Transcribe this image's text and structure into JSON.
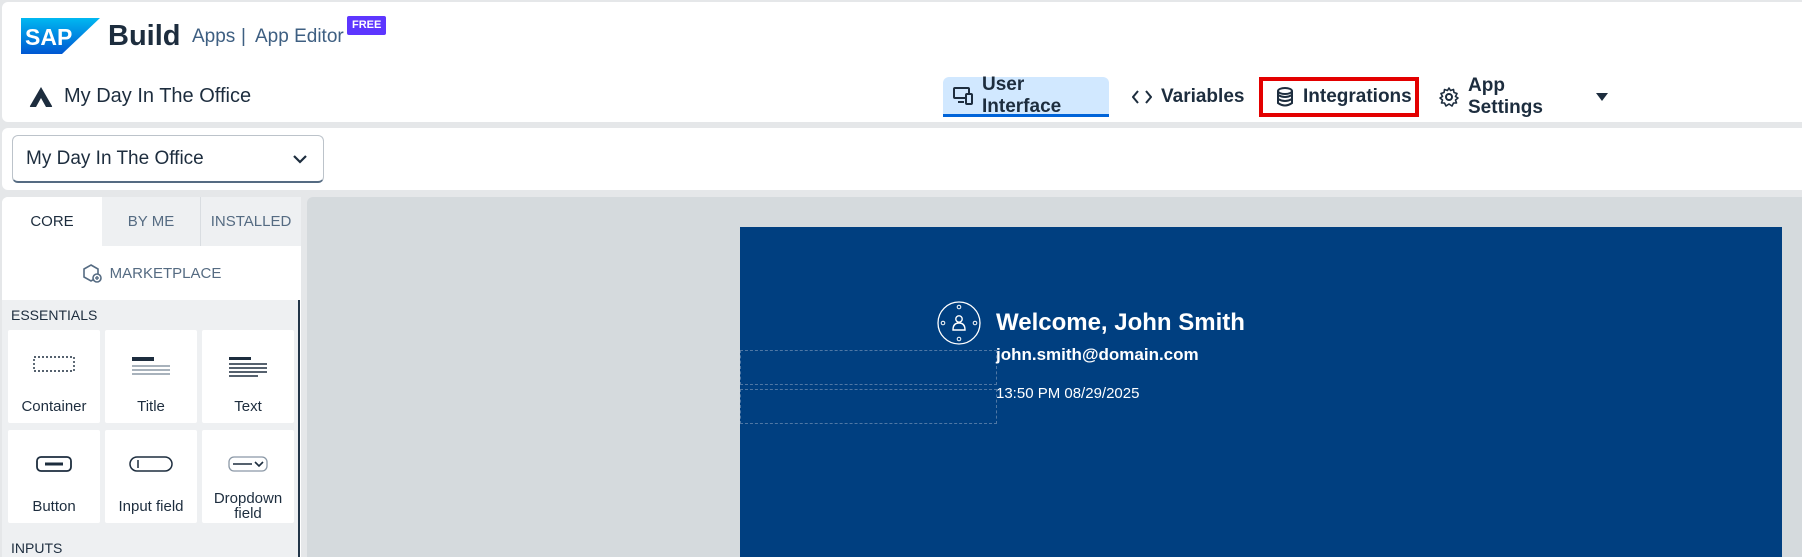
{
  "header": {
    "logo_text": "SAP",
    "brand": "Build",
    "breadcrumb": {
      "apps": "Apps",
      "separator": "|",
      "editor": "App Editor"
    },
    "badge": "FREE",
    "app_name": "My Day In The Office"
  },
  "nav_tabs": {
    "user_interface": "User Interface",
    "variables": "Variables",
    "integrations": "Integrations",
    "app_settings": "App Settings"
  },
  "app_selector": {
    "value": "My Day In The Office"
  },
  "panel": {
    "tabs": {
      "core": "CORE",
      "by_me": "BY ME",
      "installed": "INSTALLED"
    },
    "marketplace": "MARKETPLACE",
    "essentials_title": "ESSENTIALS",
    "inputs_title": "INPUTS",
    "components": {
      "container": "Container",
      "title": "Title",
      "text": "Text",
      "button": "Button",
      "input_field": "Input field",
      "dropdown_line1": "Dropdown",
      "dropdown_line2": "field"
    }
  },
  "canvas": {
    "welcome": "Welcome, John Smith",
    "email": "john.smith@domain.com",
    "datetime": "13:50 PM 08/29/2025"
  },
  "colors": {
    "accent": "#0064d9",
    "highlight_box": "#e30000",
    "page_bg": "#003f80",
    "badge": "#5d36ff",
    "selected_tab_bg": "#d1e8ff"
  }
}
